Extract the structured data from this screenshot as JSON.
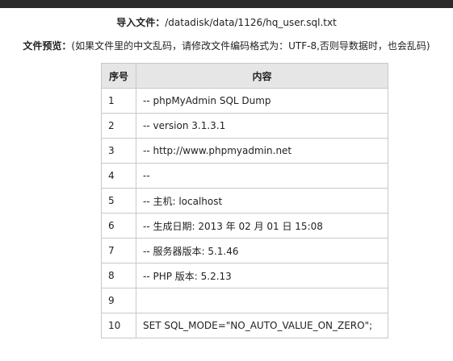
{
  "import": {
    "label": "导入文件：",
    "path": "/datadisk/data/1126/hq_user.sql.txt"
  },
  "preview": {
    "label": "文件预览：",
    "note": "(如果文件里的中文乱码，请修改文件编码格式为：UTF-8,否则导数据时，也会乱码)"
  },
  "table": {
    "headers": [
      "序号",
      "内容"
    ],
    "rows": [
      {
        "no": "1",
        "content": "-- phpMyAdmin SQL Dump"
      },
      {
        "no": "2",
        "content": "-- version 3.1.3.1"
      },
      {
        "no": "3",
        "content": "-- http://www.phpmyadmin.net"
      },
      {
        "no": "4",
        "content": "--"
      },
      {
        "no": "5",
        "content": "-- 主机: localhost"
      },
      {
        "no": "6",
        "content": "-- 生成日期: 2013 年 02 月 01 日 15:08"
      },
      {
        "no": "7",
        "content": "-- 服务器版本: 5.1.46"
      },
      {
        "no": "8",
        "content": "-- PHP 版本: 5.2.13"
      },
      {
        "no": "9",
        "content": ""
      },
      {
        "no": "10",
        "content": "SET SQL_MODE=\"NO_AUTO_VALUE_ON_ZERO\";"
      }
    ]
  }
}
